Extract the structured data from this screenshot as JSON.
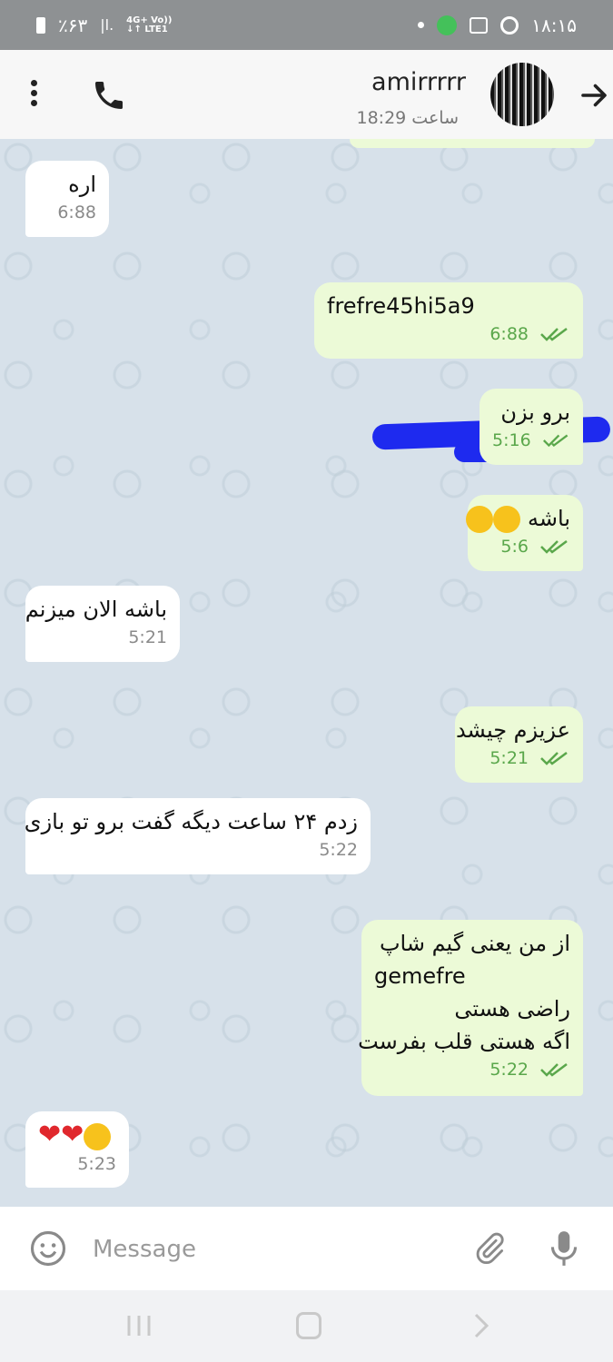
{
  "status_bar": {
    "time": "۱۸:۱۵",
    "battery": "٪۶۳",
    "network_top": "4G+ Vo))",
    "network_bottom": "↓↑ LTE1"
  },
  "header": {
    "name": "amirrrrr",
    "last_seen": "ساعت 18:29"
  },
  "messages": [
    {
      "dir": "in",
      "text": "اره",
      "time": "6:88"
    },
    {
      "dir": "out",
      "text": "frefre45hi5a9",
      "time": "6:88"
    },
    {
      "dir": "out",
      "text": "برو بزن",
      "time": "5:16"
    },
    {
      "dir": "out",
      "text": "باشه",
      "time": "5:6",
      "emoji": "grinning-face-emoji"
    },
    {
      "dir": "in",
      "text": "باشه الان میزنم",
      "time": "5:21"
    },
    {
      "dir": "out",
      "text": "عزیزم چیشد",
      "time": "5:21"
    },
    {
      "dir": "in",
      "text": "زدم ۲۴ ساعت دیگه گفت برو تو بازی",
      "time": "5:22"
    },
    {
      "dir": "out",
      "lines": [
        "از من یعنی گیم شاپ",
        "gemefre",
        "راضی هستی",
        "اگه هستی قلب بفرست"
      ],
      "time": "5:22"
    },
    {
      "dir": "in",
      "text": "❤❤",
      "time": "5:23",
      "emoji": "saluting-face-emoji"
    }
  ],
  "input": {
    "placeholder": "Message"
  },
  "colors": {
    "outgoing_bubble": "#ecfad7",
    "incoming_bubble": "#ffffff",
    "chat_background": "#d7e1ea",
    "check_color": "#5aa74b",
    "redaction": "#1e2aef"
  }
}
